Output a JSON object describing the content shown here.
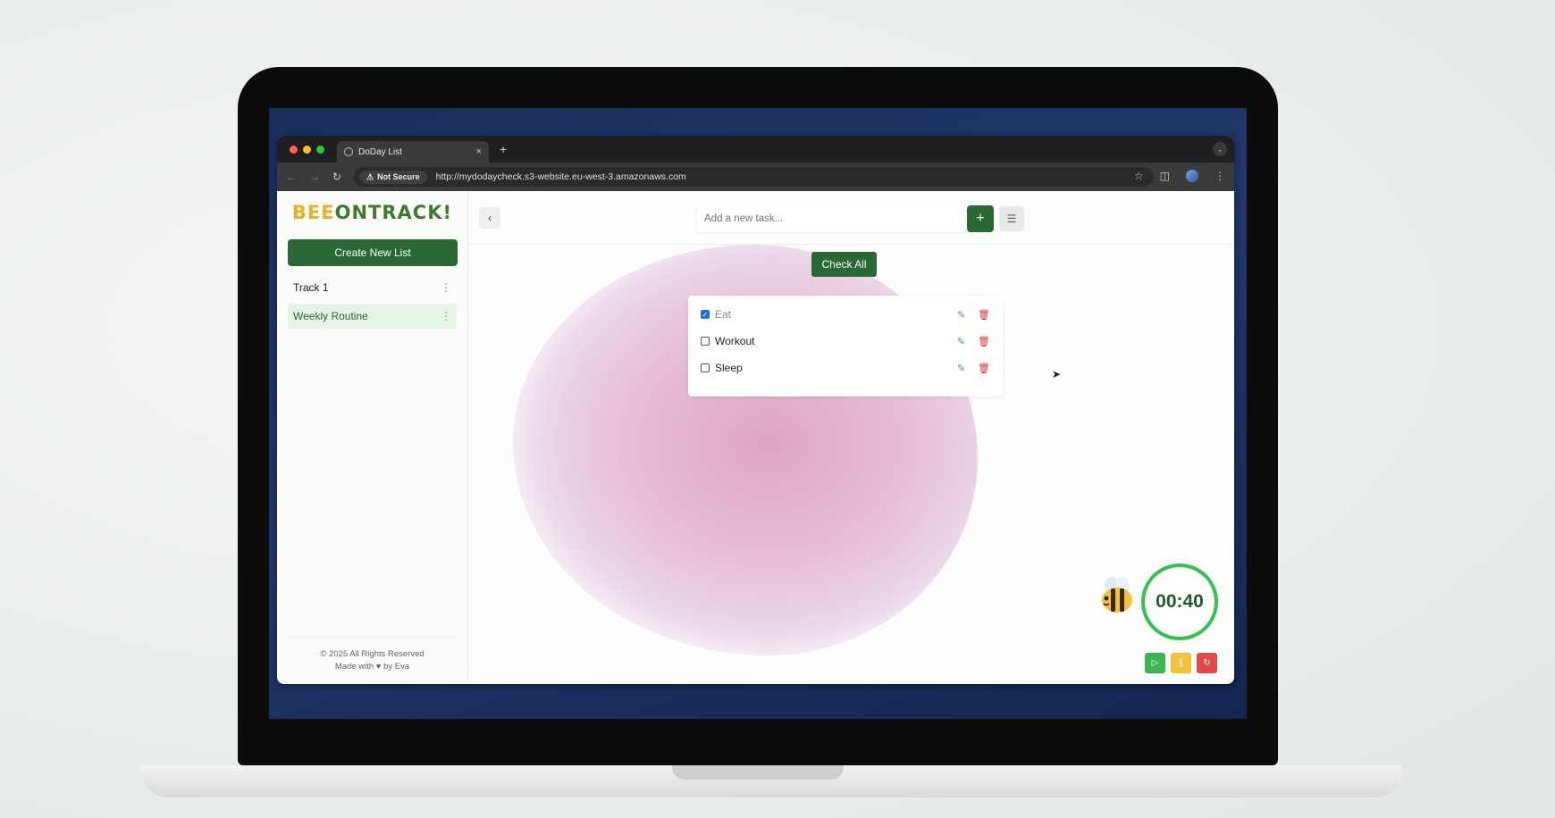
{
  "browser": {
    "tab_title": "DoDay List",
    "tab_close": "×",
    "tab_new": "+",
    "security_label": "Not Secure",
    "url": "http://mydodaycheck.s3-website.eu-west-3.amazonaws.com"
  },
  "sidebar": {
    "logo_part1": "BEE",
    "logo_part2": "ONTRACK!",
    "create_button": "Create New List",
    "lists": [
      {
        "label": "Track 1",
        "active": false
      },
      {
        "label": "Weekly Routine",
        "active": true
      }
    ],
    "footer_line1": "© 2025 All Rights Reserved",
    "footer_line2": "Made with ♥ by Eva"
  },
  "main": {
    "task_placeholder": "Add a new task...",
    "add_label": "+",
    "check_all_label": "Check All",
    "tasks": [
      {
        "label": "Eat",
        "checked": true
      },
      {
        "label": "Workout",
        "checked": false
      },
      {
        "label": "Sleep",
        "checked": false
      }
    ]
  },
  "timer": {
    "display": "00:40",
    "ring_color": "#33c24b"
  },
  "colors": {
    "primary_green": "#2c6736",
    "active_list_bg": "#e5f4e7",
    "play": "#3fb552",
    "pause": "#f3c23c",
    "reset": "#df4a4a"
  }
}
